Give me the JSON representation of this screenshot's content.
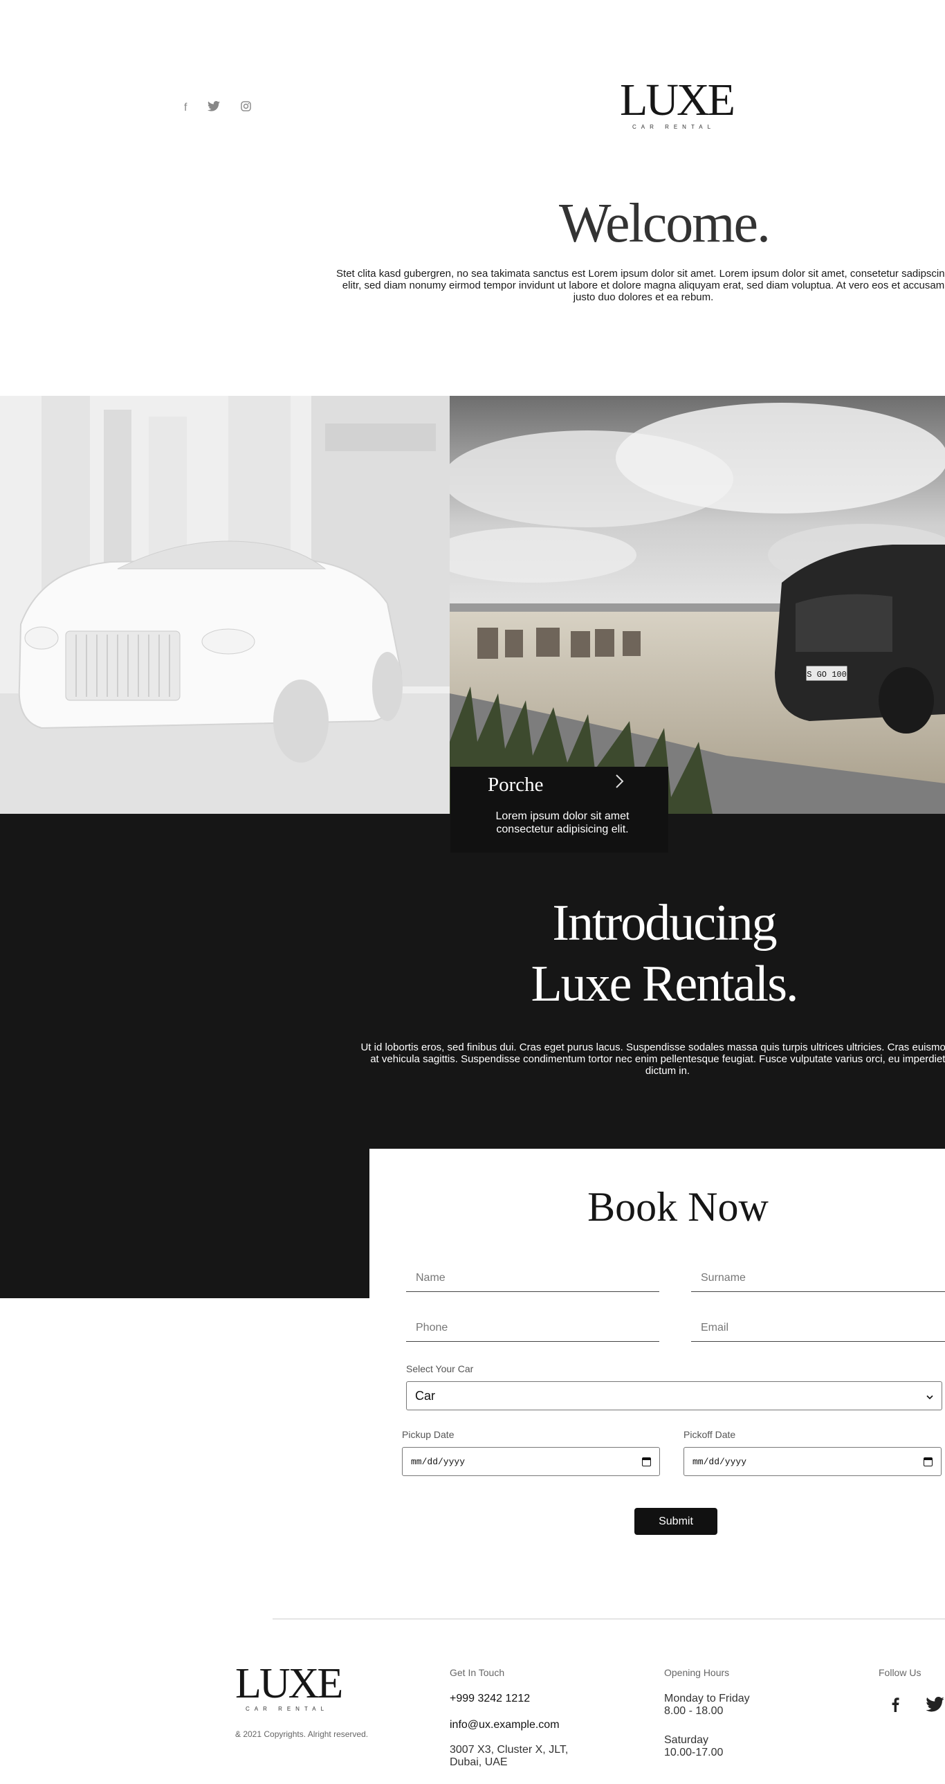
{
  "header": {
    "social": [
      {
        "name": "facebook",
        "glyph": "f"
      },
      {
        "name": "twitter",
        "glyph": "🐦"
      },
      {
        "name": "instagram",
        "glyph": "◎"
      }
    ],
    "logo_word": "LUXE",
    "logo_sub": "CAR RENTAL"
  },
  "welcome": {
    "title": "Welcome.",
    "text": "Stet clita kasd gubergren, no sea takimata sanctus est Lorem ipsum dolor sit amet. Lorem ipsum dolor sit amet, consetetur sadipscing elitr, sed diam nonumy eirmod tempor invidunt ut labore et dolore magna aliquyam erat, sed diam voluptua. At vero eos et accusam justo duo dolores et ea rebum."
  },
  "feature": {
    "card_name": "Porche",
    "card_desc": "Lorem ipsum dolor sit amet consectetur adipisicing elit.",
    "plate": "S GO 100"
  },
  "intro": {
    "title_line1": "Introducing",
    "title_line2": "Luxe Rentals.",
    "text": "Ut id lobortis eros, sed finibus dui. Cras eget purus lacus. Suspendisse sodales massa quis turpis ultrices ultricies. Cras euismod eros at vehicula sagittis. Suspendisse condimentum tortor nec enim pellentesque feugiat. Fusce vulputate varius orci, eu imperdiet orci dictum in."
  },
  "booking": {
    "title": "Book Now",
    "name_placeholder": "Name",
    "surname_placeholder": "Surname",
    "phone_placeholder": "Phone",
    "email_placeholder": "Email",
    "car_label": "Select Your Car",
    "car_value": "Car",
    "pickup_label": "Pickup Date",
    "pickoff_label": "Pickoff Date",
    "date_placeholder": "mm/dd/yyyy",
    "submit_label": "Submit"
  },
  "footer": {
    "logo_word": "LUXE",
    "logo_sub": "CAR RENTAL",
    "copyright": "& 2021 Copyrights. Alright reserved.",
    "contact_heading": "Get In Touch",
    "phone": "+999 3242 1212",
    "email": "info@ux.example.com",
    "address_line1": "3007 X3, Cluster X, JLT,",
    "address_line2": "Dubai, UAE",
    "hours_heading": "Opening Hours",
    "weekdays": "Monday to Friday",
    "weekday_hours": "8.00 - 18.00",
    "saturday": "Saturday",
    "saturday_hours": "10.00-17.00",
    "follow_heading": "Follow Us"
  },
  "colors": {
    "dark": "#161616",
    "accent": "#111111",
    "muted": "#888888"
  }
}
